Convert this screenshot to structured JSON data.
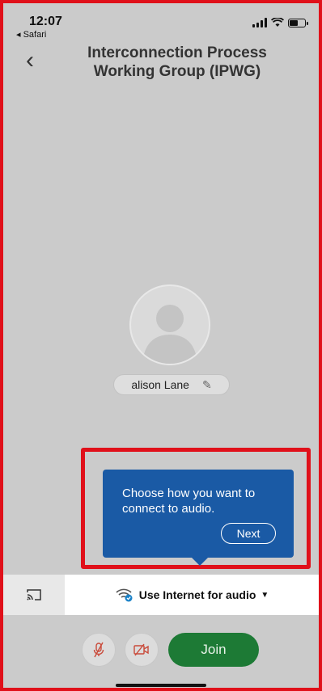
{
  "status_bar": {
    "time": "12:07",
    "back_app": "◂ Safari",
    "battery_fraction": 0.55
  },
  "header": {
    "title": "Interconnection Process Working Group (IPWG)"
  },
  "participant": {
    "name": "alison Lane"
  },
  "tooltip": {
    "text": "Choose how you want to connect to audio.",
    "next_label": "Next"
  },
  "audio": {
    "option_label": "Use Internet for audio"
  },
  "controls": {
    "join_label": "Join"
  },
  "colors": {
    "highlight": "#e0101a",
    "tooltip": "#1a5aa5",
    "join": "#1d7a35",
    "background": "#cbcbcb"
  },
  "icons": [
    "back-chevron-icon",
    "cast-icon",
    "wifi-audio-icon",
    "mic-muted-icon",
    "video-off-icon",
    "pencil-icon",
    "avatar-icon"
  ]
}
